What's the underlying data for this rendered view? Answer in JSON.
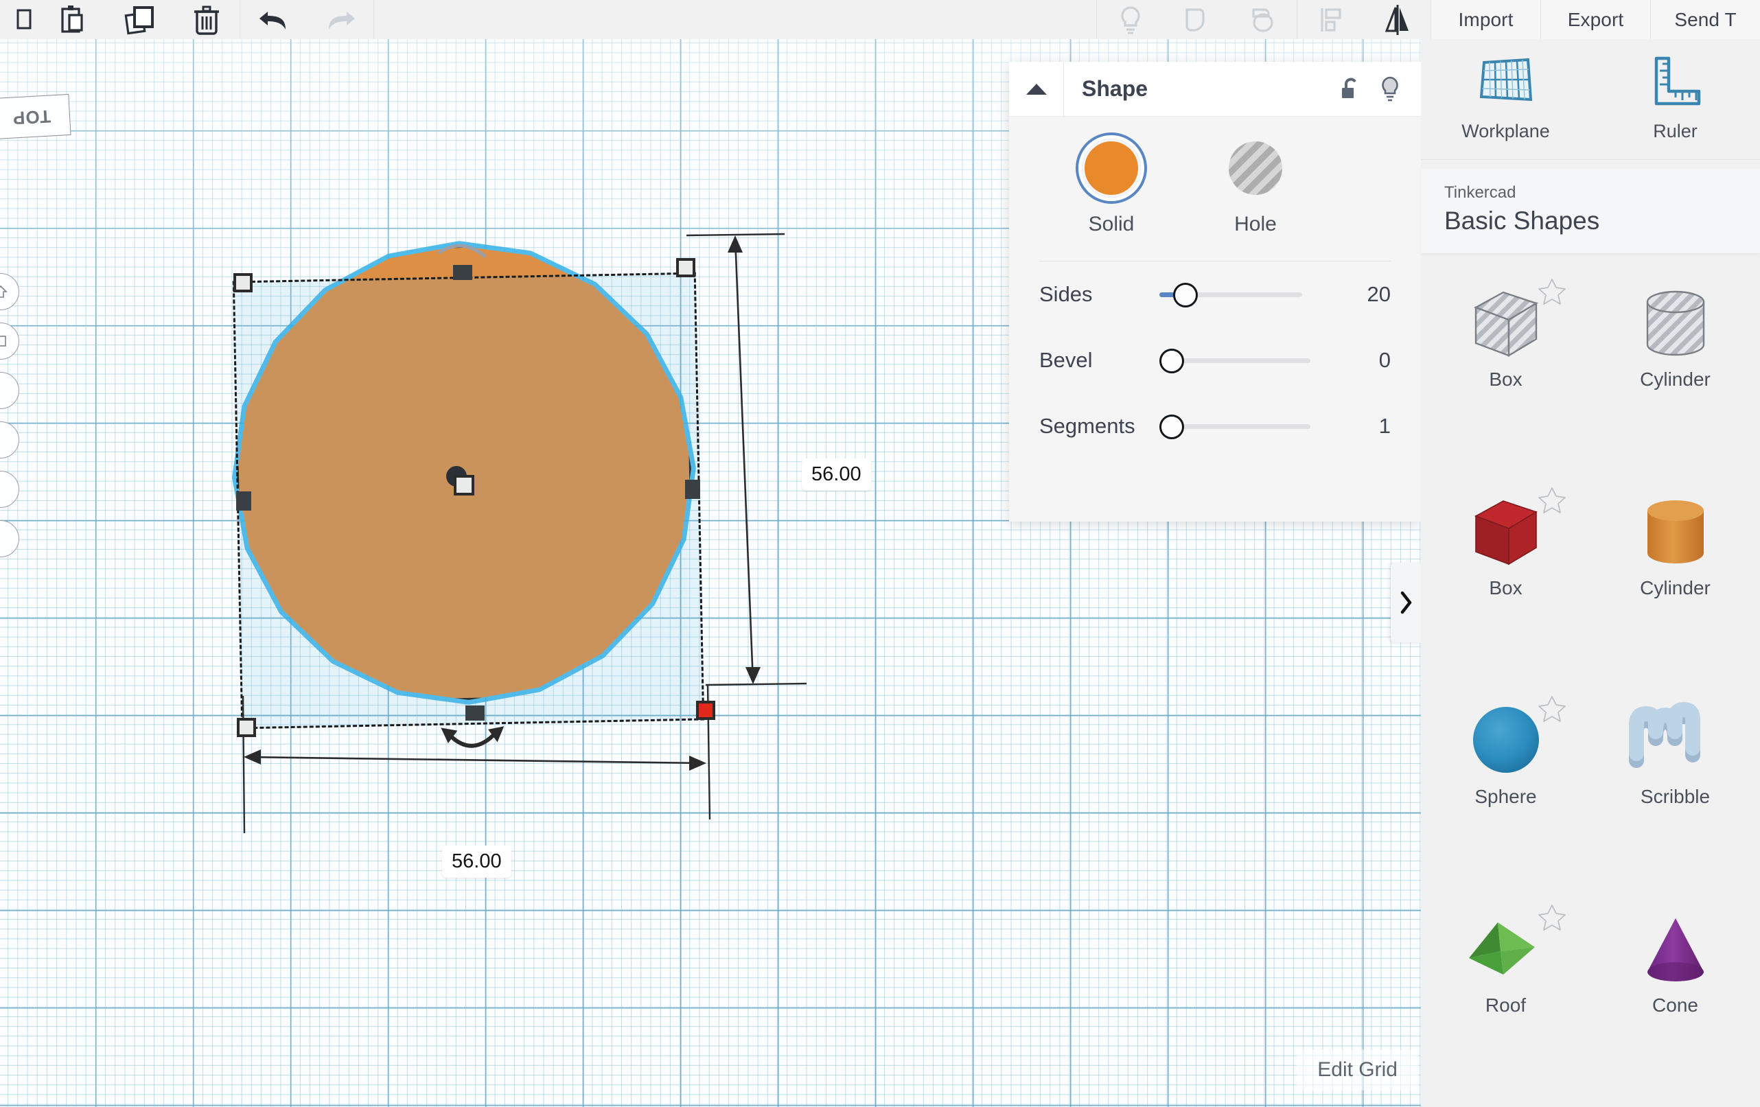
{
  "toolbar": {
    "left_icons": [
      {
        "name": "paste-icon",
        "label": "Paste"
      },
      {
        "name": "duplicate-icon",
        "label": "Duplicate"
      },
      {
        "name": "delete-icon",
        "label": "Delete"
      },
      {
        "name": "undo-icon",
        "label": "Undo"
      },
      {
        "name": "redo-icon",
        "label": "Redo"
      }
    ],
    "right_icons": [
      {
        "name": "lightbulb-icon",
        "label": "Show all / Hide"
      },
      {
        "name": "group-icon",
        "label": "Group"
      },
      {
        "name": "ungroup-icon",
        "label": "Ungroup"
      },
      {
        "name": "align-icon",
        "label": "Align"
      },
      {
        "name": "mirror-icon",
        "label": "Mirror"
      }
    ],
    "buttons": [
      {
        "name": "import-button",
        "label": "Import"
      },
      {
        "name": "export-button",
        "label": "Export"
      },
      {
        "name": "send-to-button",
        "label": "Send T"
      }
    ]
  },
  "canvas": {
    "view_label": "TOP",
    "edit_grid_label": "Edit Grid",
    "dimension_height": "56.00",
    "dimension_width": "56.00",
    "shape_color": "#dd8f45",
    "selection_glow_color": "#31b0e8",
    "selected_handle_color": "#e0291b",
    "grid_line_color": "#5fa0be"
  },
  "shape_panel": {
    "title": "Shape",
    "collapse_icon": "triangle-up-icon",
    "lock_icon": "unlock-icon",
    "visibility_icon": "lightbulb-icon",
    "modes": [
      {
        "name": "solid",
        "label": "Solid",
        "color": "#e8892b",
        "selected": true
      },
      {
        "name": "hole",
        "label": "Hole",
        "color": "#b3b3b3",
        "selected": false
      }
    ],
    "sliders": [
      {
        "name": "sides",
        "label": "Sides",
        "value": "20",
        "thumb_pct": 12,
        "fill_pct": 9
      },
      {
        "name": "bevel",
        "label": "Bevel",
        "value": "0",
        "thumb_pct": 0,
        "fill_pct": 0
      },
      {
        "name": "segments",
        "label": "Segments",
        "value": "1",
        "thumb_pct": 0,
        "fill_pct": 0
      }
    ]
  },
  "sidebar": {
    "tools": [
      {
        "name": "workplane-tool",
        "label": "Workplane",
        "icon": "workplane-icon"
      },
      {
        "name": "ruler-tool",
        "label": "Ruler",
        "icon": "ruler-icon"
      }
    ],
    "category": {
      "supertitle": "Tinkercad",
      "name": "Basic Shapes"
    },
    "collapse_tab_icon": "chevron-right-icon",
    "shapes": [
      {
        "name": "shape-box-hole",
        "label": "Box",
        "art": "box",
        "color": "#c9cdd2",
        "hatched": true,
        "starred": false
      },
      {
        "name": "shape-cylinder-hole",
        "label": "Cylinder",
        "art": "cylinder",
        "color": "#c9cdd2",
        "hatched": true,
        "starred": false
      },
      {
        "name": "shape-box-solid",
        "label": "Box",
        "art": "box",
        "color": "#b6252a",
        "hatched": false,
        "starred": true
      },
      {
        "name": "shape-cylinder-solid",
        "label": "Cylinder",
        "art": "cylinder",
        "color": "#dd8f3a",
        "hatched": false,
        "starred": false
      },
      {
        "name": "shape-sphere",
        "label": "Sphere",
        "art": "sphere",
        "color": "#2b8cbe",
        "hatched": false,
        "starred": true
      },
      {
        "name": "shape-scribble",
        "label": "Scribble",
        "art": "scribble",
        "color": "#a8c4dc",
        "hatched": false,
        "starred": false
      },
      {
        "name": "shape-roof",
        "label": "Roof",
        "art": "roof",
        "color": "#4b9b3c",
        "hatched": false,
        "starred": true
      },
      {
        "name": "shape-cone",
        "label": "Cone",
        "art": "cone",
        "color": "#7b2d8e",
        "hatched": false,
        "starred": false
      }
    ]
  }
}
